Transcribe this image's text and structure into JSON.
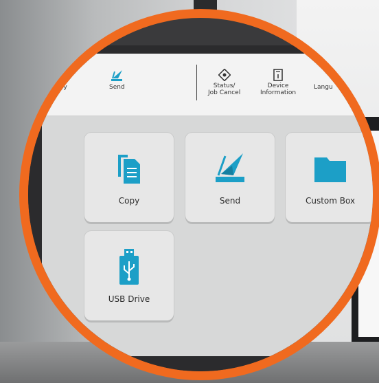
{
  "accent_color": "#1c9fc7",
  "ring_color": "#f06a1f",
  "topbar": {
    "copy_label": "Copy",
    "send_label": "Send",
    "status_label_line1": "Status/",
    "status_label_line2": "Job Cancel",
    "device_label_line1": "Device",
    "device_label_line2": "Information",
    "language_label": "Langu"
  },
  "tiles": {
    "copy": "Copy",
    "send": "Send",
    "custom_box": "Custom Box",
    "usb_drive": "USB Drive"
  }
}
